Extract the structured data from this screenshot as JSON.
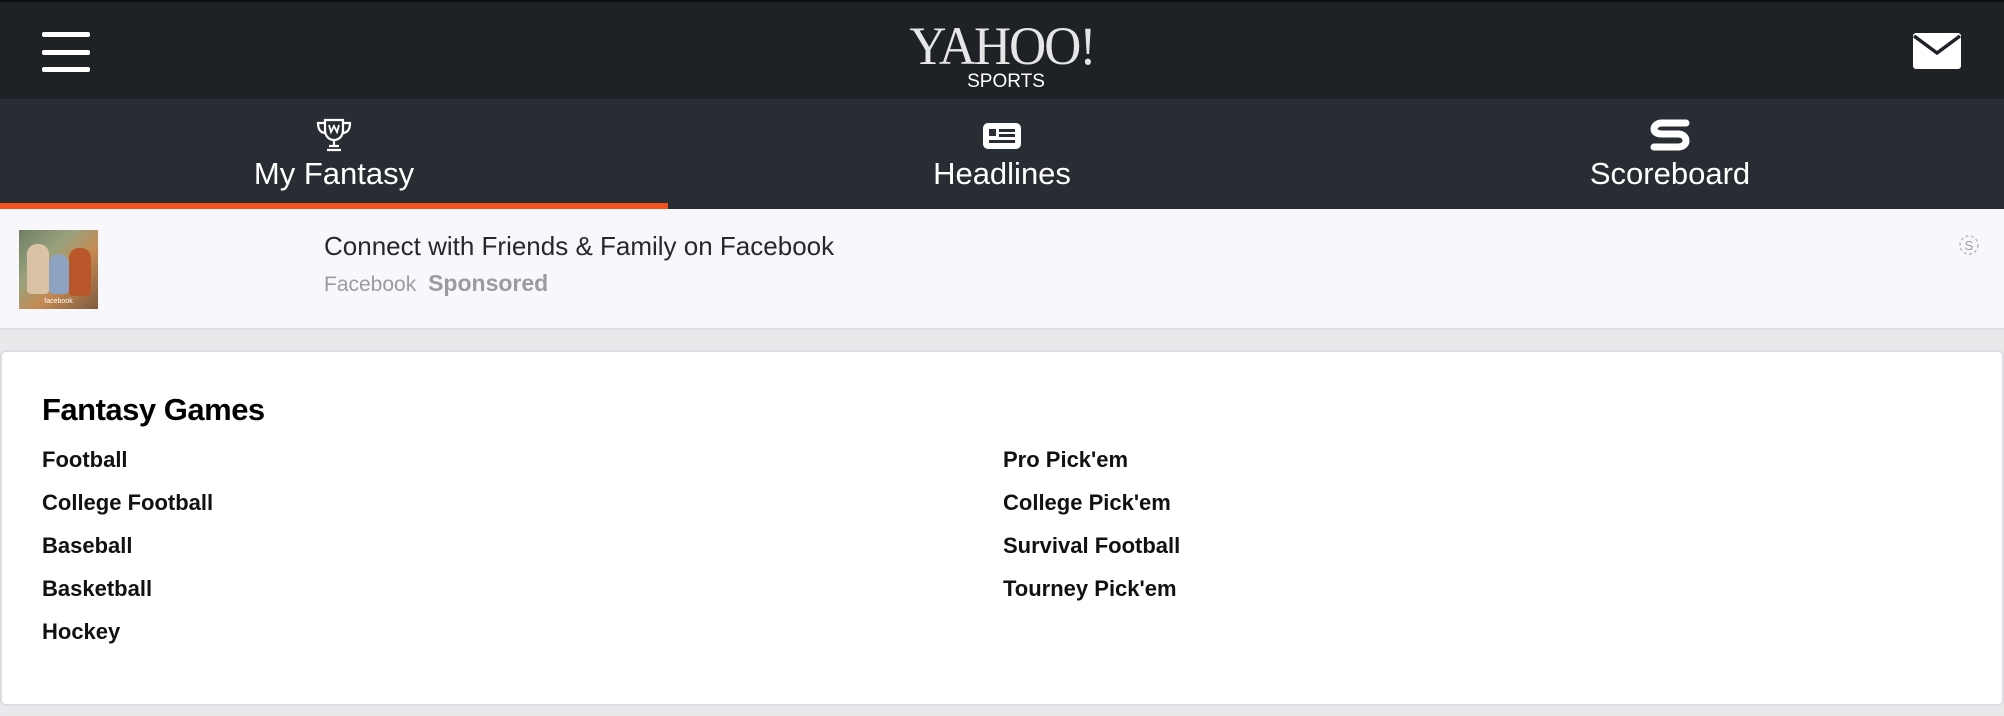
{
  "header": {
    "logo_text": "YAHOO!",
    "logo_sub": "SPORTS",
    "menu_icon": "hamburger-menu-icon",
    "mail_icon": "mail-icon"
  },
  "nav": {
    "tabs": [
      {
        "label": "My Fantasy",
        "icon": "trophy-icon",
        "active": true
      },
      {
        "label": "Headlines",
        "icon": "newspaper-icon",
        "active": false
      },
      {
        "label": "Scoreboard",
        "icon": "scoreboard-s-icon",
        "active": false
      }
    ]
  },
  "ad": {
    "title": "Connect with Friends & Family on Facebook",
    "source": "Facebook",
    "sponsored": "Sponsored",
    "thumb_label": "facebook",
    "adchoice_icon": "ad-choices-icon"
  },
  "fantasy": {
    "title": "Fantasy Games",
    "left_games": [
      "Football",
      "College Football",
      "Baseball",
      "Basketball",
      "Hockey"
    ],
    "right_games": [
      "Pro Pick'em",
      "College Pick'em",
      "Survival Football",
      "Tourney Pick'em"
    ]
  },
  "colors": {
    "topbar": "#1e2126",
    "navbar": "#282c33",
    "accent": "#f4511e",
    "ad_bg": "#f8f8fc"
  }
}
